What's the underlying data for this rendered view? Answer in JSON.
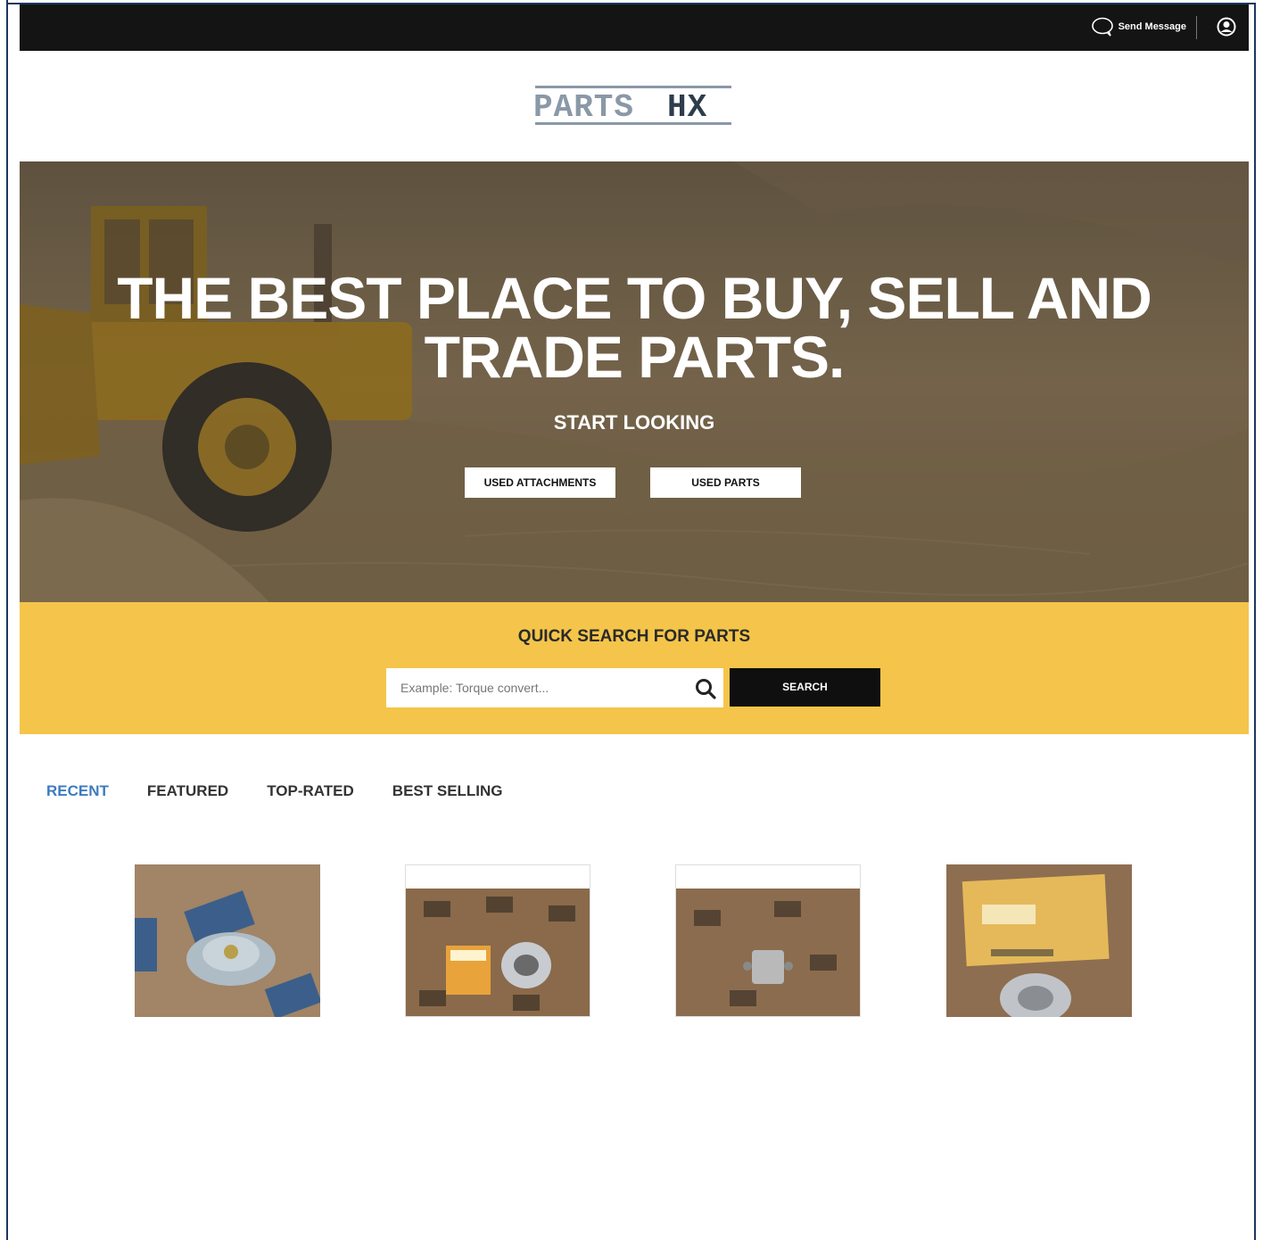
{
  "header": {
    "send_message_label": "Send Message",
    "icons": [
      "chat-bubble-icon",
      "user-account-icon"
    ]
  },
  "logo": {
    "text_light": "PARTS",
    "text_dark": "HX"
  },
  "hero": {
    "title": "THE BEST PLACE TO BUY, SELL AND TRADE PARTS.",
    "subtitle": "START LOOKING",
    "buttons": [
      {
        "label": "USED ATTACHMENTS"
      },
      {
        "label": "USED PARTS"
      }
    ]
  },
  "quick_search": {
    "title": "QUICK SEARCH FOR PARTS",
    "placeholder": "Example: Torque convert...",
    "value": "",
    "button_label": "SEARCH"
  },
  "tabs": [
    {
      "label": "RECENT",
      "active": true
    },
    {
      "label": "FEATURED",
      "active": false
    },
    {
      "label": "TOP-RATED",
      "active": false
    },
    {
      "label": "BEST SELLING",
      "active": false
    }
  ],
  "products": [
    {
      "image": "radiator-cap-photo"
    },
    {
      "image": "cat-bearing-box-photo"
    },
    {
      "image": "solenoid-switch-photo"
    },
    {
      "image": "cat-boxed-part-photo"
    }
  ],
  "colors": {
    "topbar": "#141414",
    "accent_yellow": "#f4c54a",
    "active_tab": "#3d7bbf",
    "logo_gray": "#8a98a8",
    "logo_dark": "#2e3d4d"
  }
}
